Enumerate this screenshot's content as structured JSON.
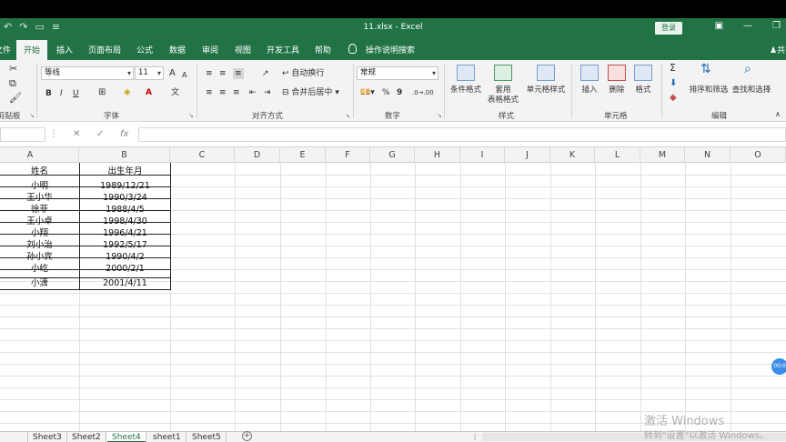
{
  "window": {
    "title": "11.xlsx  -  Excel",
    "login_label": "登录"
  },
  "ribbon_tabs": [
    "文件",
    "开始",
    "插入",
    "页面布局",
    "公式",
    "数据",
    "审阅",
    "视图",
    "开发工具",
    "帮助"
  ],
  "active_tab": "开始",
  "tellme": "操作说明搜索",
  "share_label": "共",
  "clipboard": {
    "label": "剪贴板"
  },
  "font": {
    "name": "等线",
    "size": "11",
    "label": "字体",
    "bold": "B",
    "italic": "I",
    "underline": "U",
    "grow": "A",
    "shrink": "A"
  },
  "alignment": {
    "wrap": "自动换行",
    "merge": "合并后居中",
    "label": "对齐方式"
  },
  "number": {
    "format": "常规",
    "label": "数字",
    "percent": "%",
    "comma": "9"
  },
  "styles": {
    "conditional": "条件格式",
    "table_line1": "套用",
    "table_line2": "表格格式",
    "cell_styles": "单元格样式",
    "label": "样式"
  },
  "cells": {
    "insert": "插入",
    "delete": "删除",
    "format": "格式",
    "label": "单元格"
  },
  "editing": {
    "sort": "排序和筛选",
    "find": "查找和选择",
    "label": "编辑",
    "sum": "Σ"
  },
  "formula_bar": {
    "fx": "fx",
    "cancel": "✕",
    "confirm": "✓"
  },
  "columns": [
    "A",
    "B",
    "C",
    "D",
    "E",
    "F",
    "G",
    "H",
    "I",
    "J",
    "K",
    "L",
    "M",
    "N",
    "O"
  ],
  "table": {
    "headers": [
      "姓名",
      "出生年月"
    ],
    "rows": [
      [
        "小明",
        "1989/12/21"
      ],
      [
        "王小华",
        "1990/3/24"
      ],
      [
        "徐菲",
        "1988/4/5"
      ],
      [
        "王小卓",
        "1998/4/30"
      ],
      [
        "小翔",
        "1996/4/21"
      ],
      [
        "刘小治",
        "1992/5/17"
      ],
      [
        "孙小宾",
        "1990/4/2"
      ],
      [
        "小屹",
        "2000/2/1"
      ],
      [
        "小潇",
        "2001/4/11"
      ]
    ]
  },
  "sheets": [
    "Sheet3",
    "Sheet2",
    "Sheet4",
    "sheet1",
    "Sheet5"
  ],
  "active_sheet": "Sheet4",
  "watermark": {
    "line1": "激活 Windows",
    "line2": "转到\"设置\"以激活 Windows。"
  },
  "bubble": "00:0"
}
